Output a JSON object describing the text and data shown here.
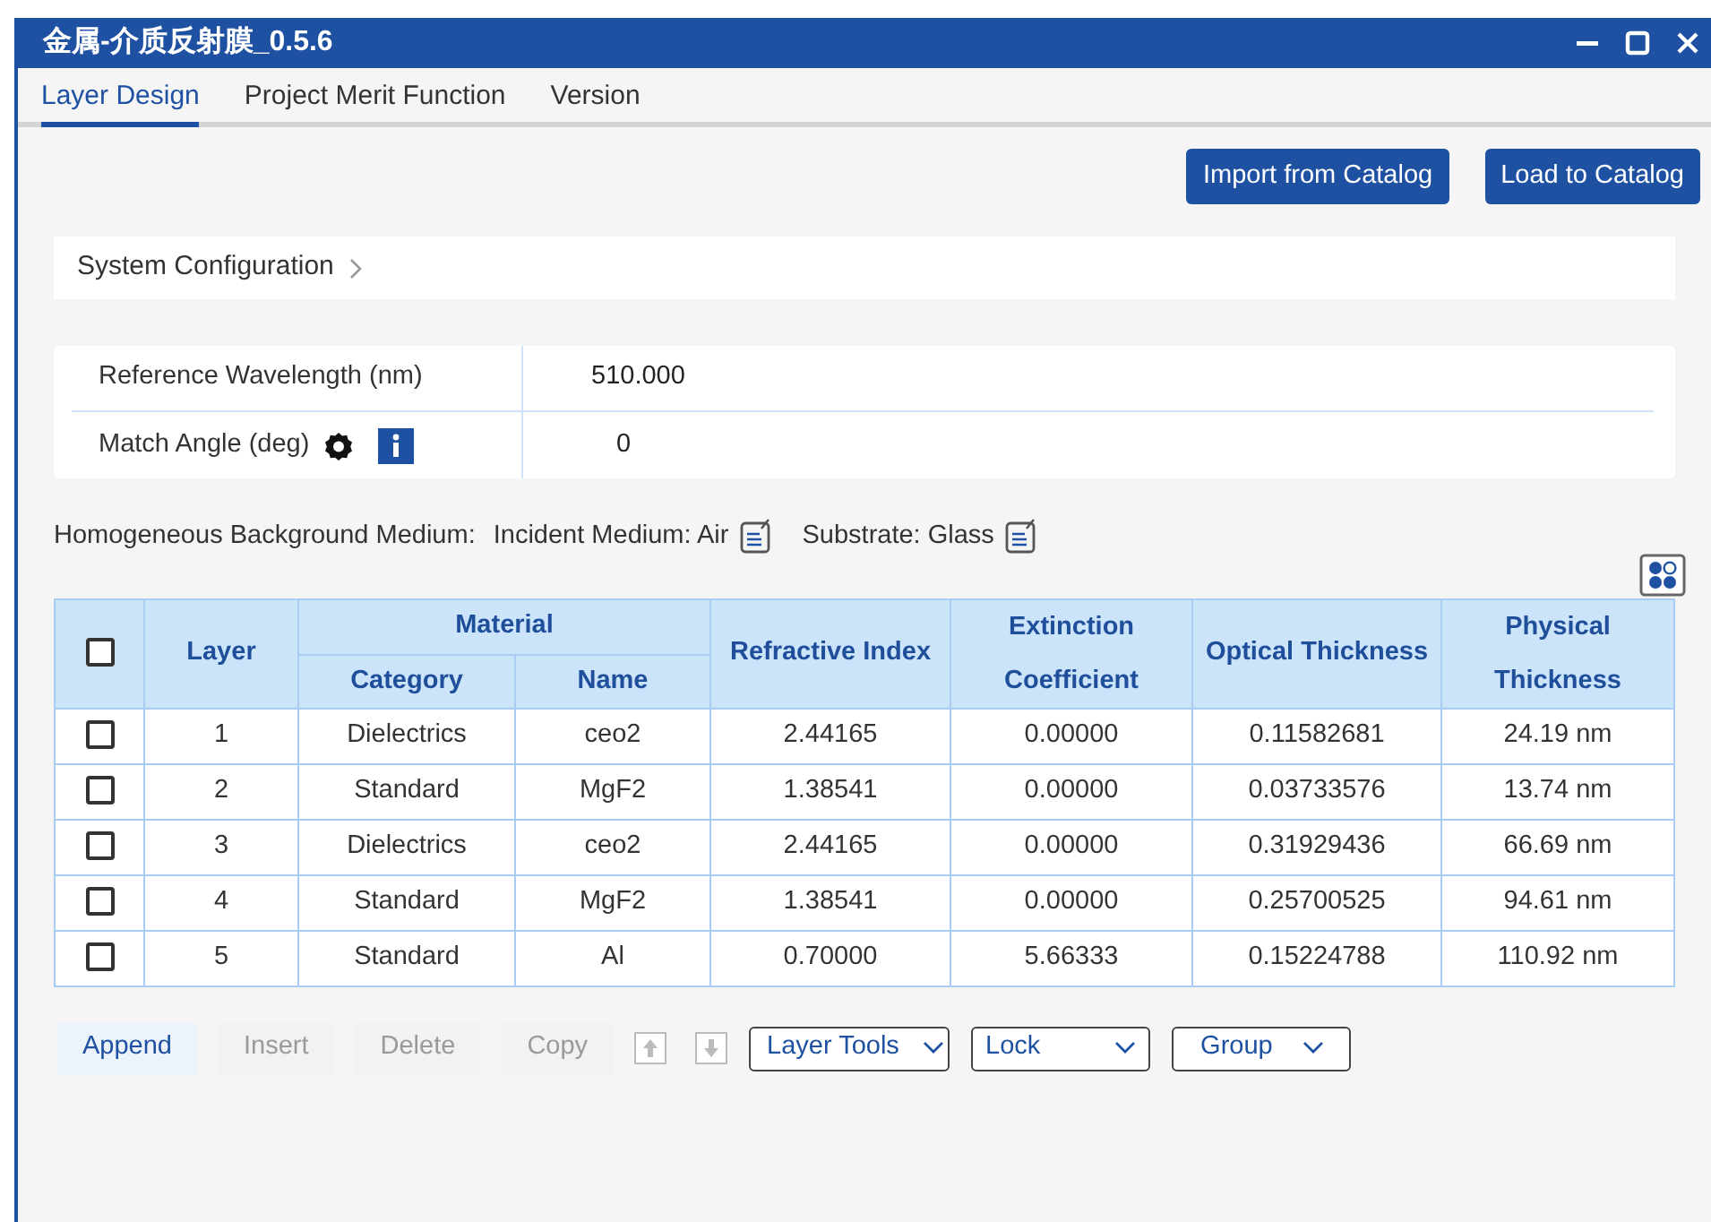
{
  "window": {
    "title": "金属-介质反射膜_0.5.6"
  },
  "tabs": [
    {
      "label": "Layer Design",
      "selected": true
    },
    {
      "label": "Project Merit Function",
      "selected": false
    },
    {
      "label": "Version",
      "selected": false
    }
  ],
  "actions": [
    "Import from Catalog",
    "Load to Catalog"
  ],
  "system_configuration": {
    "label": "System Configuration",
    "expanded": false
  },
  "parameters": [
    {
      "label": "Reference Wavelength (nm)",
      "value": "510.000",
      "kind": "plain"
    },
    {
      "label": "Match Angle (deg)",
      "value": "0",
      "kind": "icons"
    }
  ],
  "background": {
    "label": "Homogeneous Background Medium:",
    "incident": "Incident Medium: Air",
    "substrate": "Substrate: Glass"
  },
  "table": {
    "all_checked": false,
    "group_header": "Material",
    "columns": [
      "Layer",
      "Category",
      "Name",
      "Refractive Index",
      "Extinction Coefficient",
      "Optical Thickness",
      "Physical Thickness"
    ],
    "rows": [
      {
        "checked": false,
        "cells": [
          "1",
          "Dielectrics",
          "ceo2",
          "2.44165",
          "0.00000",
          "0.11582681",
          "24.19 nm"
        ]
      },
      {
        "checked": false,
        "cells": [
          "2",
          "Standard",
          "MgF2",
          "1.38541",
          "0.00000",
          "0.03733576",
          "13.74 nm"
        ]
      },
      {
        "checked": false,
        "cells": [
          "3",
          "Dielectrics",
          "ceo2",
          "2.44165",
          "0.00000",
          "0.31929436",
          "66.69 nm"
        ]
      },
      {
        "checked": false,
        "cells": [
          "4",
          "Standard",
          "MgF2",
          "1.38541",
          "0.00000",
          "0.25700525",
          "94.61 nm"
        ]
      },
      {
        "checked": false,
        "cells": [
          "5",
          "Standard",
          "Al",
          "0.70000",
          "5.66333",
          "0.15224788",
          "110.92 nm"
        ]
      }
    ]
  },
  "toolbar": [
    {
      "label": "Append",
      "disabled": false
    },
    {
      "label": "Insert",
      "disabled": true
    },
    {
      "label": "Delete",
      "disabled": true
    },
    {
      "label": "Copy",
      "disabled": true
    }
  ],
  "dropdowns": [
    "Layer Tools",
    "Lock",
    "Group"
  ]
}
